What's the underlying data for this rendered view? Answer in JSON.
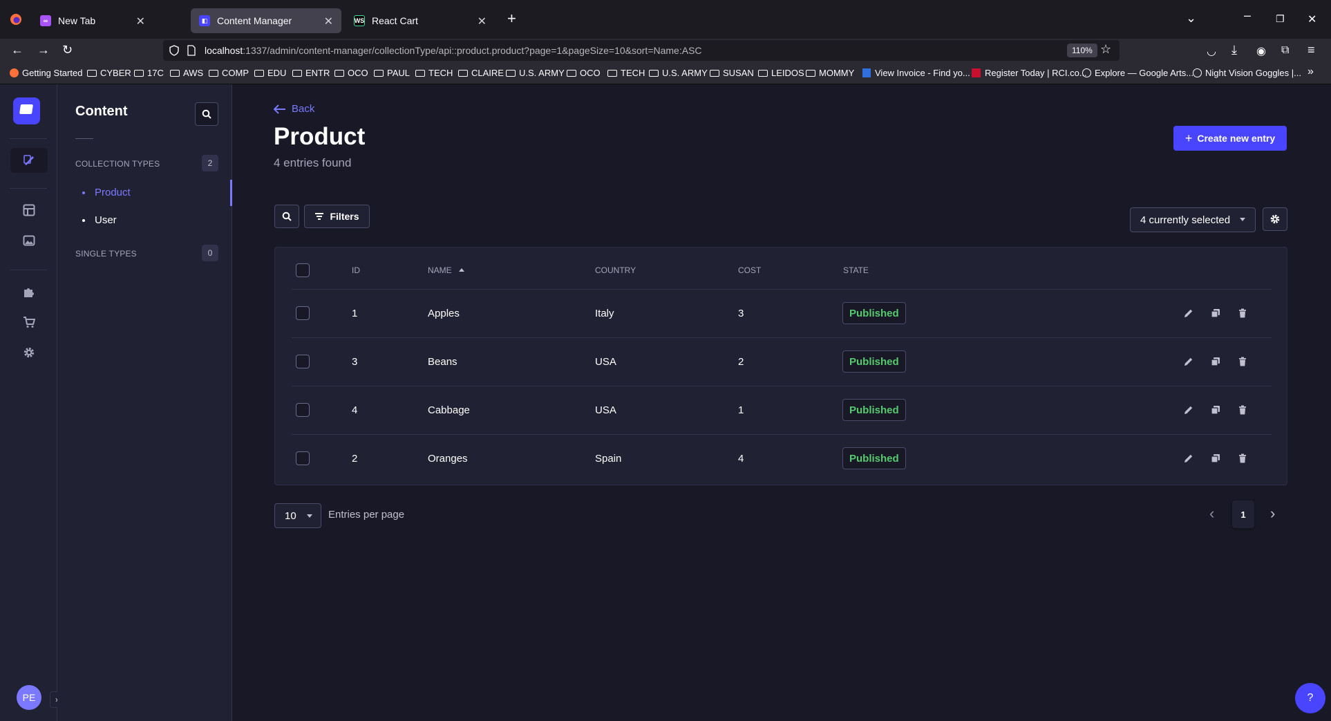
{
  "browser": {
    "tabs": [
      {
        "title": "New Tab",
        "favicon": "new-tab-icon"
      },
      {
        "title": "Content Manager",
        "favicon": "strapi-icon"
      },
      {
        "title": "React Cart",
        "favicon": "webstorm-icon"
      }
    ],
    "url_host": "localhost",
    "url_rest": ":1337/admin/content-manager/collectionType/api::product.product?page=1&pageSize=10&sort=Name:ASC",
    "zoom": "110%",
    "bookmarks": [
      "Getting Started",
      "CYBER",
      "17C",
      "AWS",
      "COMP",
      "EDU",
      "ENTR",
      "OCO",
      "PAUL",
      "TECH",
      "CLAIRE",
      "U.S. ARMY",
      "OCO",
      "TECH",
      "U.S. ARMY",
      "SUSAN",
      "LEIDOS",
      "MOMMY",
      "View Invoice - Find yo...",
      "Register Today | RCI.co...",
      "Explore — Google Arts...",
      "Night Vision Goggles |..."
    ]
  },
  "subnav": {
    "title": "Content",
    "collection_types_label": "COLLECTION TYPES",
    "collection_types_count": "2",
    "collection_types": [
      "Product",
      "User"
    ],
    "single_types_label": "SINGLE TYPES",
    "single_types_count": "0"
  },
  "user": {
    "initials": "PE"
  },
  "header": {
    "back_label": "Back",
    "title": "Product",
    "subtitle": "4 entries found",
    "create_label": "Create new entry"
  },
  "toolbar": {
    "filters_label": "Filters",
    "columns_label": "4 currently selected"
  },
  "table": {
    "headers": {
      "id": "ID",
      "name": "NAME",
      "country": "COUNTRY",
      "cost": "COST",
      "state": "STATE"
    },
    "rows": [
      {
        "id": "1",
        "name": "Apples",
        "country": "Italy",
        "cost": "3",
        "state": "Published"
      },
      {
        "id": "3",
        "name": "Beans",
        "country": "USA",
        "cost": "2",
        "state": "Published"
      },
      {
        "id": "4",
        "name": "Cabbage",
        "country": "USA",
        "cost": "1",
        "state": "Published"
      },
      {
        "id": "2",
        "name": "Oranges",
        "country": "Spain",
        "cost": "4",
        "state": "Published"
      }
    ]
  },
  "pagination": {
    "page_size": "10",
    "per_page_label": "Entries per page",
    "current_page": "1"
  },
  "help_label": "?",
  "colors": {
    "accent": "#4945ff",
    "published": "#55cb6e",
    "background": "#181826"
  }
}
